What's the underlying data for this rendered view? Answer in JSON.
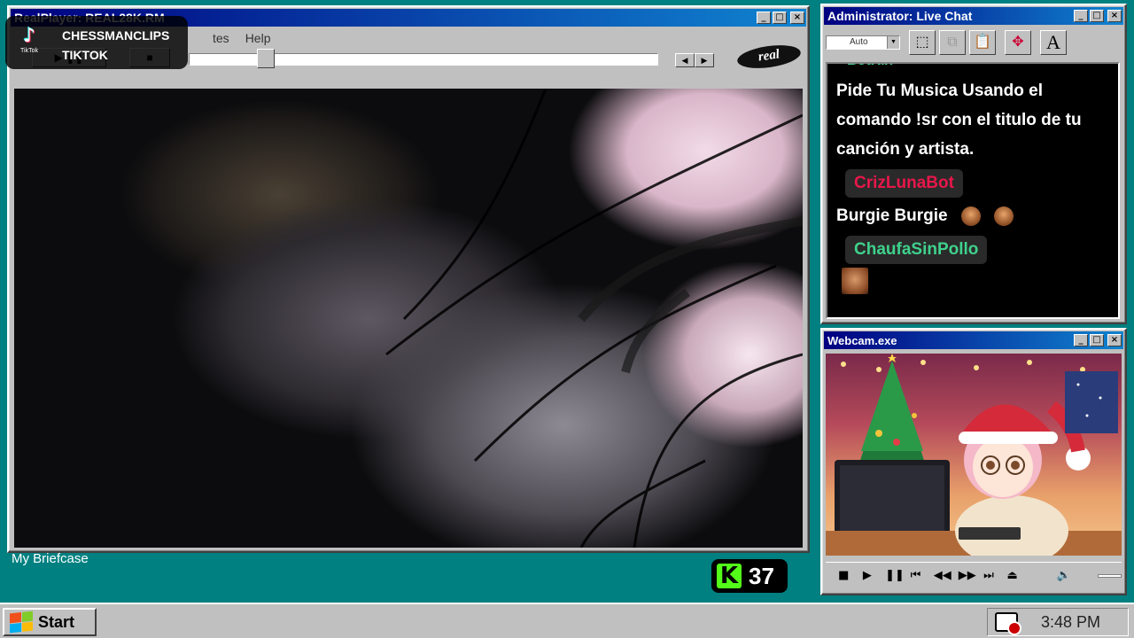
{
  "realplayer": {
    "title": "RealPlayer: REAL28K.RM",
    "menu": [
      "tes",
      "Help"
    ],
    "logo_text": "real",
    "seek_position": 0.15,
    "window_buttons": {
      "minimize": "_",
      "maximize": "□",
      "close": "×"
    }
  },
  "tiktok_overlay": {
    "logo_label": "TikTok",
    "line1": "CHESSMANCLIPS",
    "line2": "TIKTOK"
  },
  "desktop": {
    "briefcase_label": "My Briefcase"
  },
  "kick": {
    "icon_letter": "K",
    "viewer_count": "37",
    "brand_color": "#53fc18"
  },
  "livechat": {
    "title": "Administrator: Live Chat",
    "font_select": "Auto",
    "toolbar_icons": [
      "select-icon",
      "copy-icon",
      "paste-icon",
      "move-icon",
      "font-icon"
    ],
    "font_button": "A",
    "cut_off_text": "BotRix",
    "messages": [
      {
        "type": "text",
        "text": "Pide Tu Musica Usando el comando !sr con el titulo de tu canción y artista."
      },
      {
        "type": "user",
        "name": "CrizLunaBot",
        "color": "#e8174a"
      },
      {
        "type": "text",
        "text": "Burgie Burgie",
        "emotes": 2
      },
      {
        "type": "user",
        "name": "ChaufaSinPollo",
        "color": "#3fd18c"
      },
      {
        "type": "emote-only"
      }
    ]
  },
  "webcam": {
    "title": "Webcam.exe",
    "controls": [
      "■",
      "▶",
      "❚❚",
      "⏮",
      "◀◀",
      "▶▶",
      "⏭",
      "⏏",
      "🔈"
    ]
  },
  "taskbar": {
    "start_label": "Start",
    "clock": "3:48 PM"
  }
}
